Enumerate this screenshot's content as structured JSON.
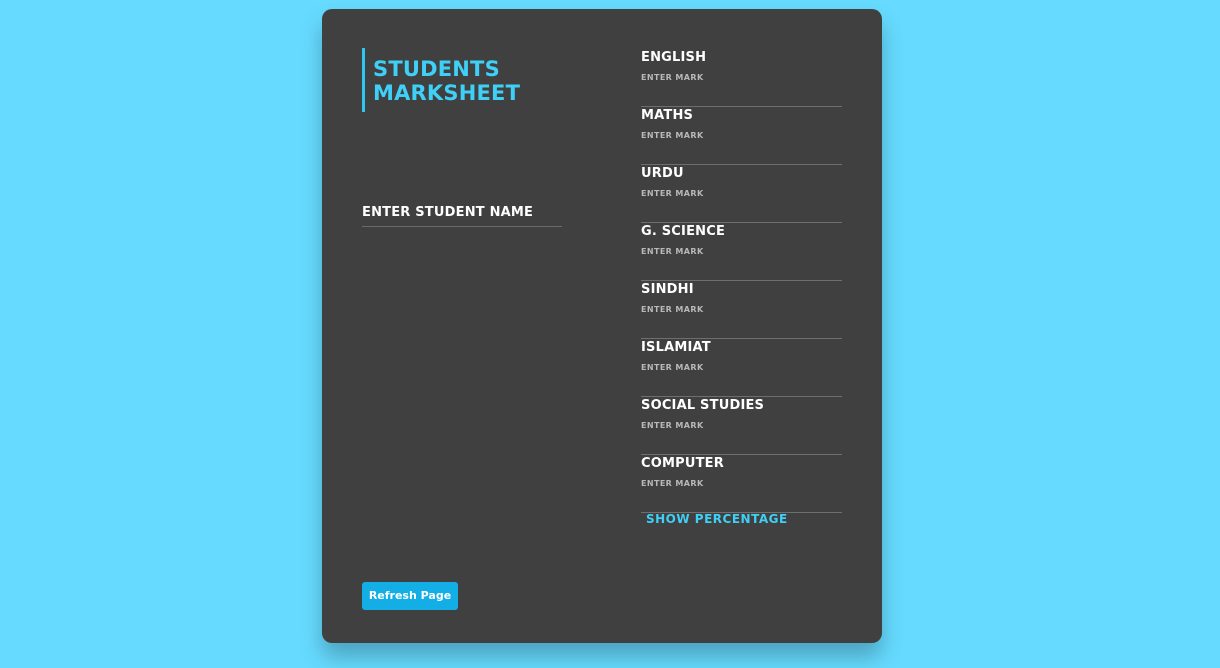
{
  "title": {
    "line1": "STUDENTS",
    "line2": "MARKSHEET"
  },
  "student_name": {
    "label": "ENTER STUDENT NAME"
  },
  "subjects": [
    {
      "name": "ENGLISH",
      "placeholder": "ENTER MARK"
    },
    {
      "name": "MATHS",
      "placeholder": "ENTER MARK"
    },
    {
      "name": "URDU",
      "placeholder": "ENTER MARK"
    },
    {
      "name": "G. SCIENCE",
      "placeholder": "ENTER MARK"
    },
    {
      "name": "SINDHI",
      "placeholder": "ENTER MARK"
    },
    {
      "name": "ISLAMIAT",
      "placeholder": "ENTER MARK"
    },
    {
      "name": "SOCIAL STUDIES",
      "placeholder": "ENTER MARK"
    },
    {
      "name": "COMPUTER",
      "placeholder": "ENTER MARK"
    }
  ],
  "buttons": {
    "show_percentage": "SHOW PERCENTAGE",
    "refresh": "Refresh Page"
  },
  "colors": {
    "background": "#66dbff",
    "card": "#404040",
    "accent": "#3fd0f8",
    "button": "#13aee6"
  }
}
